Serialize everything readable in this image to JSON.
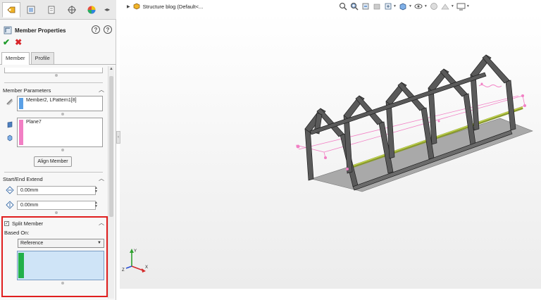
{
  "panel": {
    "title": "Member Properties",
    "help_icon": "help-icon",
    "subtabs": [
      "Member",
      "Profile"
    ],
    "member_parameters": {
      "heading": "Member Parameters",
      "selection_1": "Member2, LPattern1[8]",
      "selection_2": "Plane7",
      "align_button": "Align Member"
    },
    "start_end_extend": {
      "heading": "Start/End Extend",
      "start_value": "0.00mm",
      "end_value": "0.00mm"
    },
    "split_member": {
      "heading": "Split Member",
      "checked": true,
      "based_on_label": "Based On:",
      "based_on_value": "Reference",
      "selection_value": ""
    }
  },
  "breadcrumb": {
    "text": "Structure blog  (Default<..."
  },
  "colors": {
    "accent_blue": "#5aa0e6",
    "accent_pink": "#f27fc4",
    "accent_green": "#22b04a",
    "highlight_red": "#e01e1e",
    "selection_fill": "#cfe4f7"
  },
  "triad": {
    "x": "X",
    "y": "Y",
    "z": "Z"
  }
}
